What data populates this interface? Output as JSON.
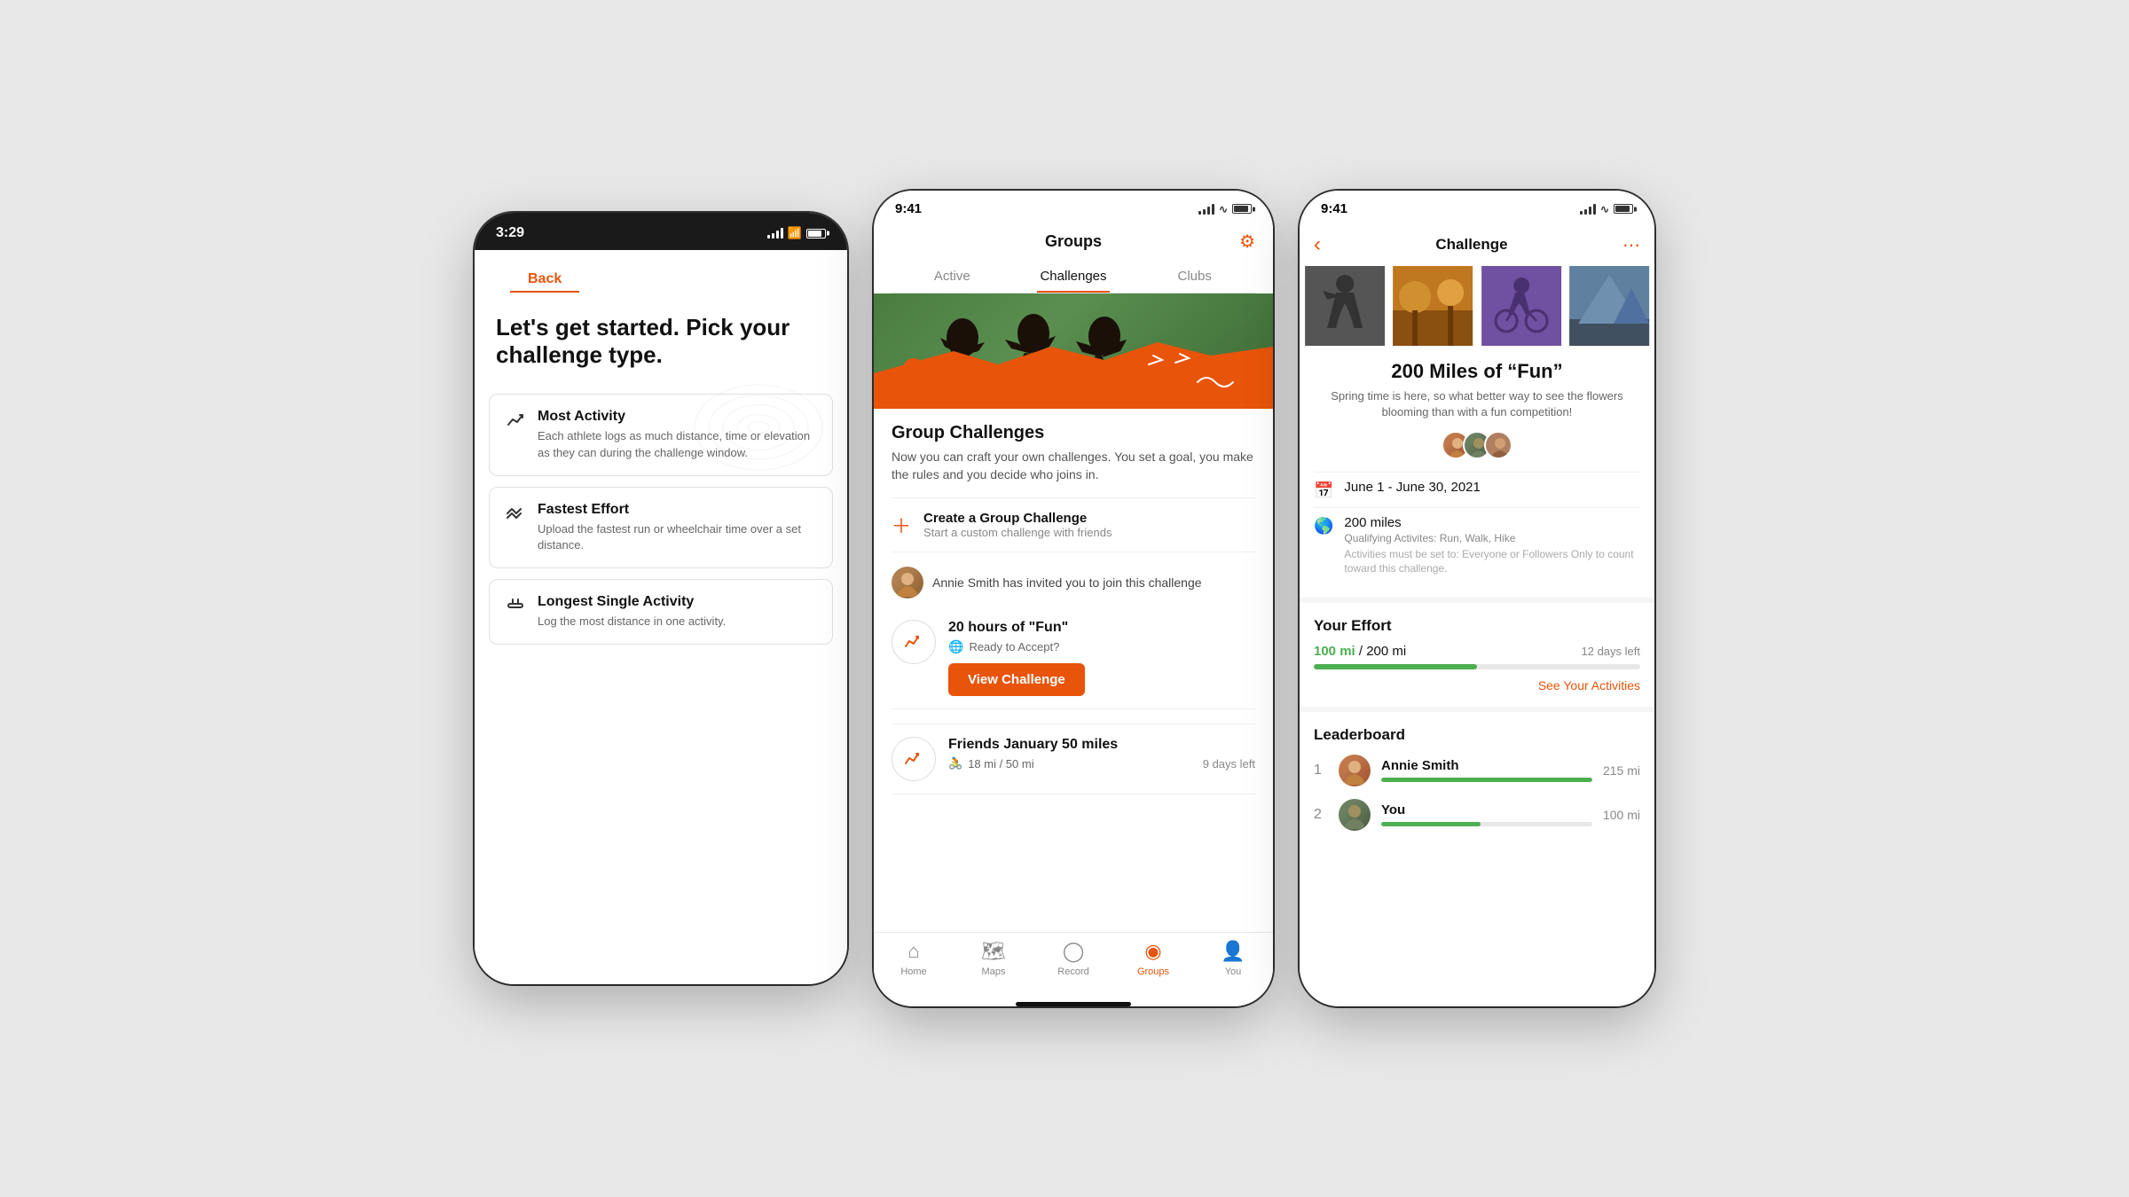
{
  "screen1": {
    "status_time": "3:29",
    "back_label": "Back",
    "title": "Let's get started. Pick your challenge type.",
    "options": [
      {
        "id": "most-activity",
        "icon": "↗",
        "title": "Most Activity",
        "description": "Each athlete logs as much distance, time or elevation as they can during the challenge window."
      },
      {
        "id": "fastest-effort",
        "icon": "⇌",
        "title": "Fastest Effort",
        "description": "Upload the fastest run or wheelchair time over a set distance."
      },
      {
        "id": "longest-single",
        "icon": "⟳",
        "title": "Longest Single Activity",
        "description": "Log the most distance in one activity."
      }
    ]
  },
  "screen2": {
    "status_time": "9:41",
    "title": "Groups",
    "tabs": [
      "Active",
      "Challenges",
      "Clubs"
    ],
    "active_tab": "Challenges",
    "group_challenges_title": "Group Challenges",
    "group_challenges_desc": "Now you can craft your own challenges. You set a goal, you make the rules and you decide who joins in.",
    "create_challenge": {
      "title": "Create a Group Challenge",
      "subtitle": "Start a custom challenge with friends"
    },
    "invite_text": "Annie Smith has invited you to join this challenge",
    "challenge1": {
      "title": "20 hours of \"Fun\"",
      "meta": "Ready to Accept?",
      "button": "View Challenge"
    },
    "challenge2": {
      "title": "Friends January 50 miles",
      "meta": "18 mi / 50 mi",
      "days_left": "9 days left"
    },
    "nav": {
      "home": "Home",
      "maps": "Maps",
      "record": "Record",
      "groups": "Groups",
      "you": "You"
    }
  },
  "screen3": {
    "status_time": "9:41",
    "header_title": "Challenge",
    "challenge_title": "200 Miles of “Fun”",
    "challenge_description": "Spring time is here, so what better way to see the flowers blooming than with a fun competition!",
    "date_range": "June 1 - June 30, 2021",
    "distance": "200 miles",
    "qualifying": "Qualifying Activites: Run, Walk, Hike",
    "activities_note": "Activities must be set to: Everyone or Followers Only to count toward this challenge.",
    "your_effort_title": "Your Effort",
    "current_miles": "100 mi",
    "total_miles": "200 mi",
    "days_left": "12 days left",
    "progress_pct": 50,
    "see_activities": "See Your Activities",
    "leaderboard_title": "Leaderboard",
    "leaderboard": [
      {
        "rank": 1,
        "name": "Annie Smith",
        "miles": "215 mi",
        "progress": 100
      },
      {
        "rank": 2,
        "name": "You",
        "miles": "100 mi",
        "progress": 47
      }
    ]
  }
}
